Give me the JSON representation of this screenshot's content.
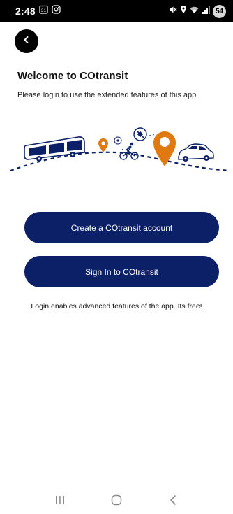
{
  "status_bar": {
    "time": "2:48",
    "calendar_day": "31",
    "battery": "54",
    "icons": [
      "calendar-icon",
      "instagram-icon",
      "mute-icon",
      "location-icon",
      "wifi-icon",
      "signal-icon",
      "battery-icon"
    ]
  },
  "header": {
    "back_icon": "chevron-left-icon"
  },
  "welcome": {
    "title": "Welcome to COtransit",
    "subtitle": "Please login to use the extended features of this app"
  },
  "illustration": {
    "elements": [
      "bus-icon",
      "location-pin-icon",
      "cyclist-icon",
      "satellite-icon",
      "car-icon"
    ],
    "accent_color": "#e07a10",
    "line_color": "#0c2068"
  },
  "actions": {
    "create_account": "Create a COtransit account",
    "sign_in": "Sign In to COtransit"
  },
  "footer_note": "Login enables advanced features of the app. Its free!",
  "nav_bar": {
    "icons": [
      "recent-apps-icon",
      "home-icon",
      "back-icon"
    ]
  },
  "colors": {
    "primary": "#0c2068",
    "accent": "#e07a10",
    "status_bar": "#000000"
  }
}
